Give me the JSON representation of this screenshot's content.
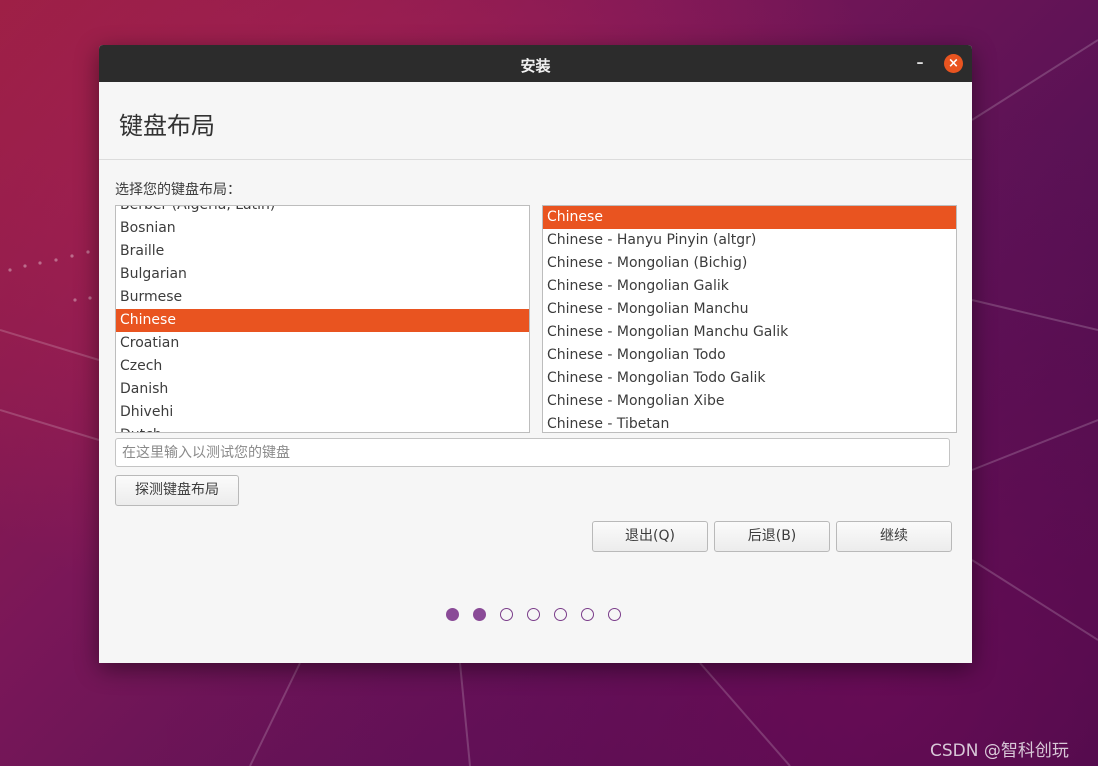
{
  "window": {
    "title": "安装",
    "minimize_glyph": "–",
    "close_glyph": "×"
  },
  "page": {
    "title": "键盘布局",
    "prompt": "选择您的键盘布局："
  },
  "layouts": [
    {
      "label": "Berber (Algeria, Latin)"
    },
    {
      "label": "Bosnian"
    },
    {
      "label": "Braille"
    },
    {
      "label": "Bulgarian"
    },
    {
      "label": "Burmese"
    },
    {
      "label": "Chinese"
    },
    {
      "label": "Croatian"
    },
    {
      "label": "Czech"
    },
    {
      "label": "Danish"
    },
    {
      "label": "Dhivehi"
    },
    {
      "label": "Dutch"
    }
  ],
  "selected_layout": "Chinese",
  "variants": [
    {
      "label": "Chinese"
    },
    {
      "label": "Chinese - Hanyu Pinyin (altgr)"
    },
    {
      "label": "Chinese - Mongolian (Bichig)"
    },
    {
      "label": "Chinese - Mongolian Galik"
    },
    {
      "label": "Chinese - Mongolian Manchu"
    },
    {
      "label": "Chinese - Mongolian Manchu Galik"
    },
    {
      "label": "Chinese - Mongolian Todo"
    },
    {
      "label": "Chinese - Mongolian Todo Galik"
    },
    {
      "label": "Chinese - Mongolian Xibe"
    },
    {
      "label": "Chinese - Tibetan"
    }
  ],
  "selected_variant": "Chinese",
  "test_field": {
    "placeholder": "在这里输入以测试您的键盘",
    "value": ""
  },
  "buttons": {
    "detect": "探测键盘布局",
    "quit": "退出(Q)",
    "back": "后退(B)",
    "continue": "继续"
  },
  "progress": {
    "total_steps": 7,
    "completed_steps": 2
  },
  "colors": {
    "accent": "#e95420",
    "progress_dot": "#8a4b97",
    "titlebar": "#2c2c2c"
  },
  "watermark": "CSDN @智科创玩"
}
